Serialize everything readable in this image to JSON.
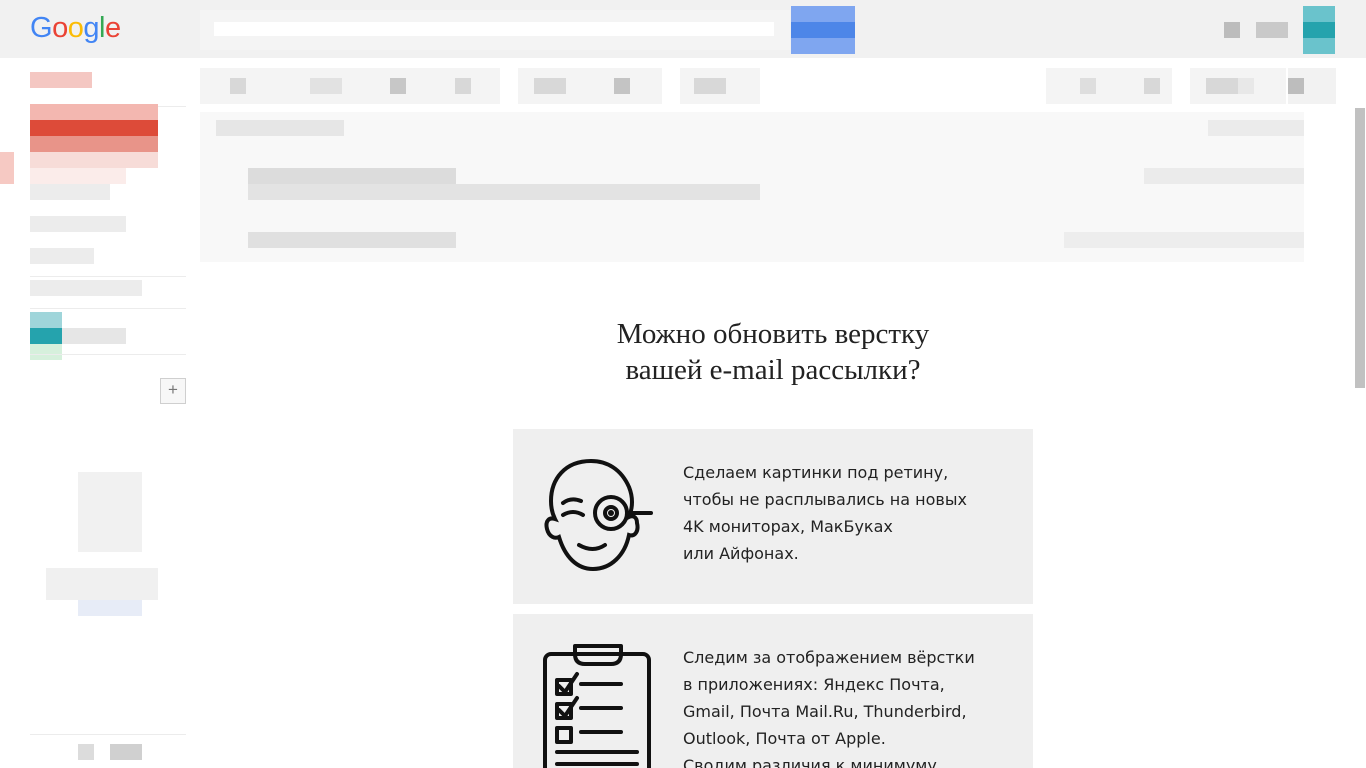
{
  "header": {
    "logo": {
      "letters": [
        "G",
        "o",
        "o",
        "g",
        "l",
        "e"
      ],
      "colors": [
        "#4285f4",
        "#ea4335",
        "#fbbc05",
        "#4285f4",
        "#34a853",
        "#ea4335"
      ]
    }
  },
  "sidebar": {
    "plus_label": "+"
  },
  "email": {
    "headline_line1": "Можно обновить верстку",
    "headline_line2": "вашей e-mail рассылки?",
    "card1": {
      "icon": "winking-face-magnifier-icon",
      "lines": [
        "Сделаем картинки под ретину,",
        "чтобы не расплывались на новых",
        "4K мониторах, МакБуках",
        "или Айфонах."
      ]
    },
    "card2": {
      "icon": "clipboard-checklist-icon",
      "lines": [
        "Следим за отображением вёрстки",
        "в приложениях: Яндекс Почта,",
        "Gmail, Почта Mail.Ru, Thunderbird,",
        "Outlook, Почта от Apple.",
        "Сводим различия к минимуму."
      ]
    }
  },
  "colors": {
    "header_bg": "#f1f1f1",
    "search_button": "#4d86e8",
    "compose_red": "#dd4b39",
    "card_bg": "#efefef",
    "avatar": "#25a3ad"
  }
}
